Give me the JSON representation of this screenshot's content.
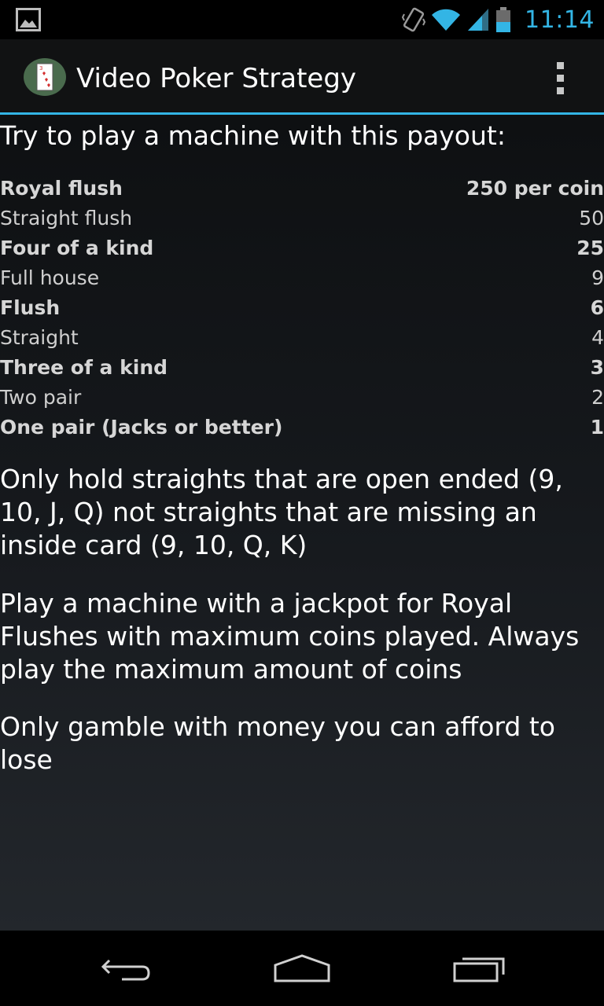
{
  "status_bar": {
    "time": "11:14",
    "icons": [
      "image-notification-icon",
      "vibrate-icon",
      "wifi-icon",
      "signal-icon",
      "battery-icon"
    ],
    "time_color": "#33b5e5"
  },
  "action_bar": {
    "title": "Video Poker Strategy",
    "app_icon": "playing-card-icon",
    "menu_icon": "overflow-menu-icon",
    "accent": "#33b5e5"
  },
  "content": {
    "intro": "Try to play a machine with this payout:",
    "payouts": [
      {
        "hand": "Royal flush",
        "payout": "250 per coin"
      },
      {
        "hand": "Straight flush",
        "payout": "50"
      },
      {
        "hand": "Four of a kind",
        "payout": "25"
      },
      {
        "hand": "Full house",
        "payout": "9"
      },
      {
        "hand": "Flush",
        "payout": "6"
      },
      {
        "hand": "Straight",
        "payout": "4"
      },
      {
        "hand": "Three of a kind",
        "payout": "3"
      },
      {
        "hand": "Two pair",
        "payout": "2"
      },
      {
        "hand": "One pair (Jacks or better)",
        "payout": "1"
      }
    ],
    "tip1": "Only hold straights that are open ended (9, 10, J, Q) not straights that are missing an inside card (9, 10, Q, K)",
    "tip2": "Play a machine with a jackpot for Royal Flushes with maximum coins played. Always play the maximum amount of coins",
    "tip3": "Only gamble with money you can afford to lose"
  },
  "nav_bar": {
    "buttons": [
      "back-icon",
      "home-icon",
      "recents-icon"
    ]
  }
}
